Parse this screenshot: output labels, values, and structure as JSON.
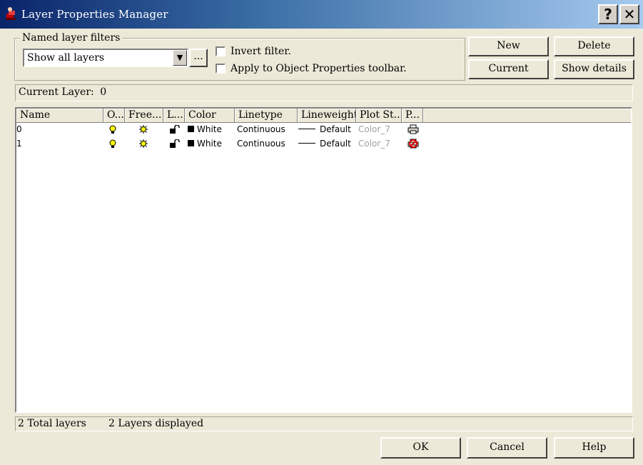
{
  "window": {
    "title": "Layer Properties Manager",
    "help_label": "?",
    "close_label": "✕"
  },
  "filters": {
    "group_label": "Named layer filters",
    "selected": "Show all layers",
    "browse_label": "...",
    "invert_filter": {
      "label": "Invert filter.",
      "checked": false
    },
    "apply_toolbar": {
      "label": "Apply to Object Properties toolbar.",
      "checked": false
    }
  },
  "buttons": {
    "new": "New",
    "delete": "Delete",
    "current": "Current",
    "show_details": "Show details",
    "ok": "OK",
    "cancel": "Cancel",
    "help": "Help"
  },
  "current_layer": {
    "label": "Current Layer:",
    "value": "0"
  },
  "columns": [
    "Name",
    "O...",
    "Free...",
    "L...",
    "Color",
    "Linetype",
    "Lineweight",
    "Plot St...",
    "P..."
  ],
  "layers": [
    {
      "name": "0",
      "on": "lightbulb-on",
      "freeze": "sun-thawed",
      "lock": "unlocked",
      "color": "White",
      "color_hex": "#000000",
      "linetype": "Continuous",
      "lineweight": "Default",
      "plot_style": "Color_7",
      "plot": "printer"
    },
    {
      "name": "1",
      "on": "lightbulb-on",
      "freeze": "sun-thawed",
      "lock": "unlocked",
      "color": "White",
      "color_hex": "#000000",
      "linetype": "Continuous",
      "lineweight": "Default",
      "plot_style": "Color_7",
      "plot": "printer-no-plot"
    }
  ],
  "status": {
    "total": "2 Total layers",
    "displayed": "2 Layers displayed"
  }
}
